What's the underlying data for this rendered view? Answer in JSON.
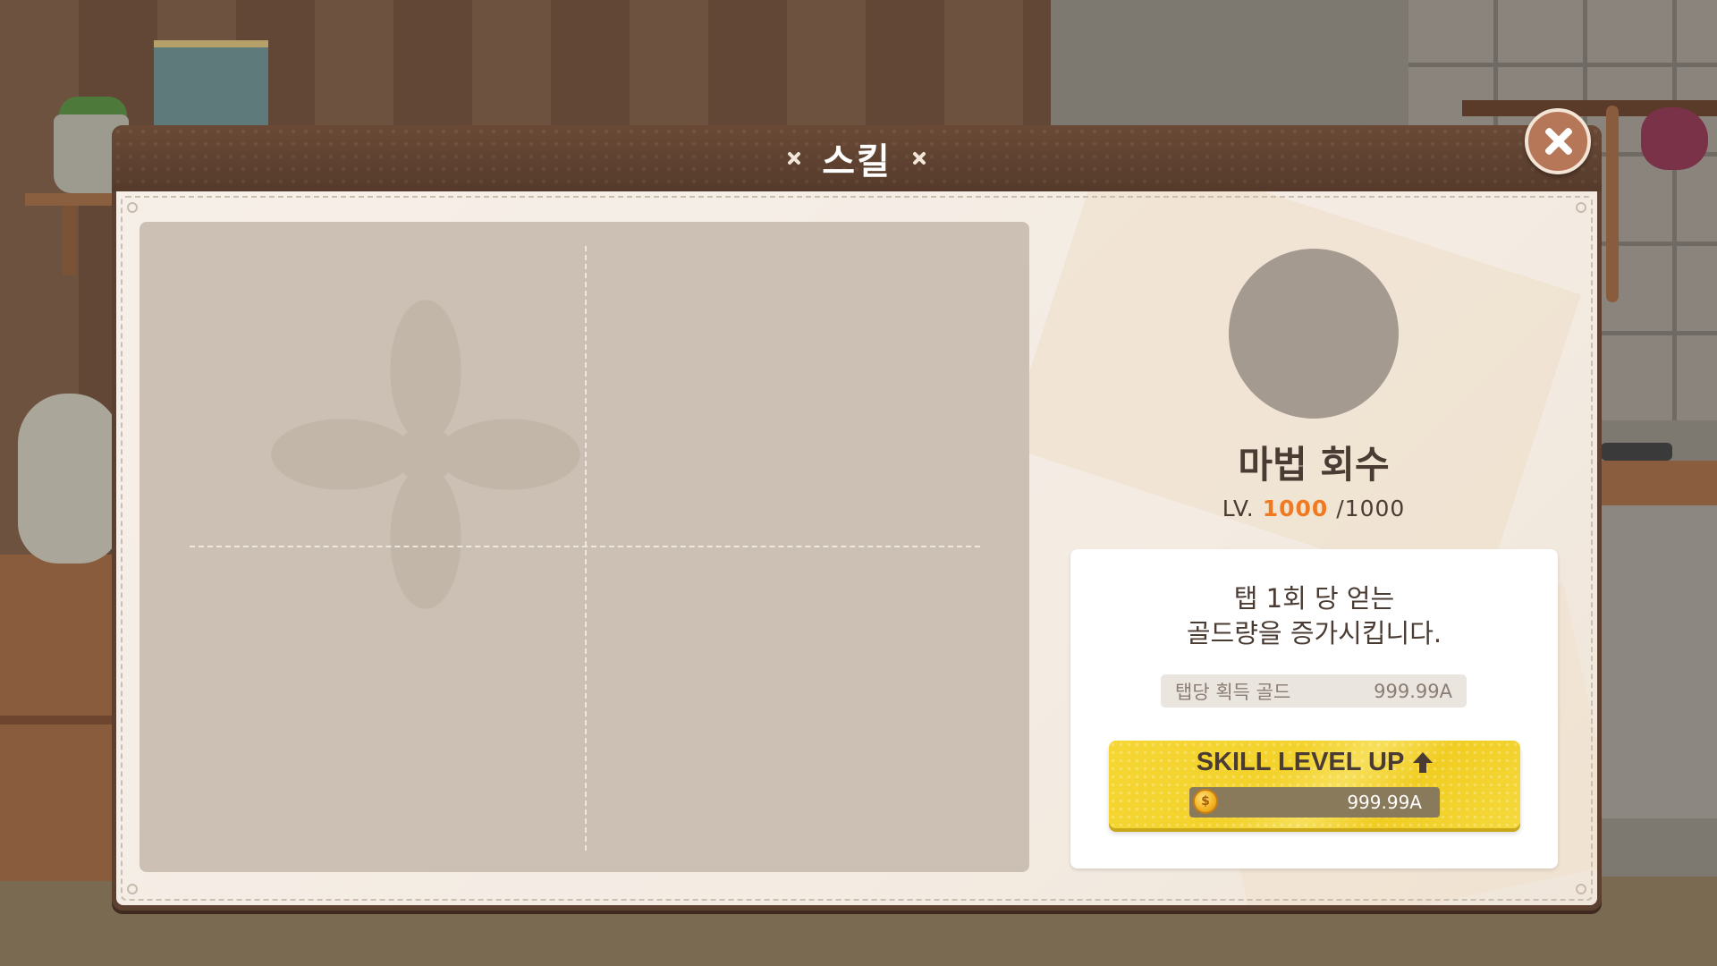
{
  "modal": {
    "title": "스킬"
  },
  "skill": {
    "name": "마법 회수",
    "level_prefix": "LV.",
    "level_current": "1000",
    "level_max": "/1000",
    "description_line1": "탭 1회 당 얻는",
    "description_line2": "골드량을 증가시킵니다.",
    "stat_label": "탭당 획득 골드",
    "stat_value": "999.99A"
  },
  "level_up_button": {
    "label": "SKILL LEVEL UP",
    "cost": "999.99A"
  },
  "colors": {
    "accent_level": "#f07a22",
    "button_yellow": "#f3d22b",
    "modal_frame": "#5c4030"
  },
  "icons": {
    "title_decoration": "sparkle-icon",
    "close": "close-icon",
    "arrow": "arrow-up-icon",
    "currency": "coin-icon"
  }
}
